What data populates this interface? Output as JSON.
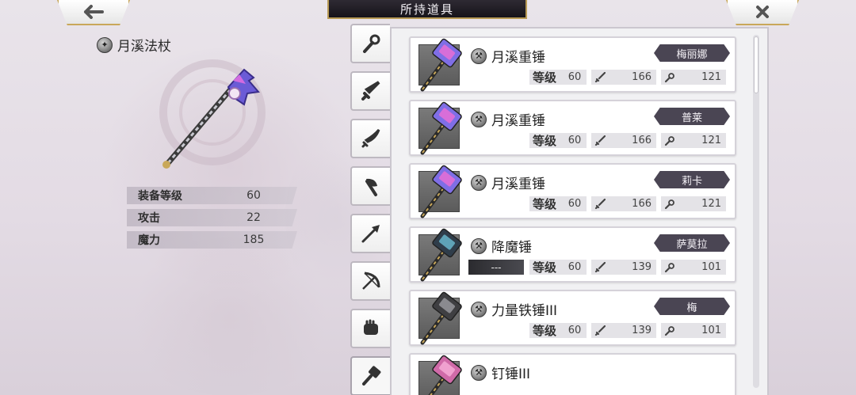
{
  "header": {
    "title": "所持道具",
    "back_icon": "back-arrow-icon",
    "close_icon": "close-icon"
  },
  "detail": {
    "name": "月溪法杖",
    "stats": [
      {
        "label": "装备等级",
        "value": "60"
      },
      {
        "label": "攻击",
        "value": "22"
      },
      {
        "label": "魔力",
        "value": "185"
      }
    ]
  },
  "tabs": [
    "staff-icon",
    "sword-icon",
    "blade-icon",
    "axe-icon",
    "spear-icon",
    "bow-icon",
    "fist-icon",
    "hammer-icon"
  ],
  "active_tab": "hammer-icon",
  "list": {
    "level_label": "等级",
    "items": [
      {
        "name": "月溪重锤",
        "owner": "梅丽娜",
        "level": "60",
        "attack": "166",
        "magic": "121",
        "equip": ""
      },
      {
        "name": "月溪重锤",
        "owner": "普莱",
        "level": "60",
        "attack": "166",
        "magic": "121",
        "equip": ""
      },
      {
        "name": "月溪重锤",
        "owner": "莉卡",
        "level": "60",
        "attack": "166",
        "magic": "121",
        "equip": ""
      },
      {
        "name": "降魔锤",
        "owner": "萨莫拉",
        "level": "60",
        "attack": "139",
        "magic": "101",
        "equip": "---"
      },
      {
        "name": "力量铁锤III",
        "owner": "梅",
        "level": "60",
        "attack": "139",
        "magic": "101",
        "equip": ""
      },
      {
        "name": "钉锤III",
        "owner": "",
        "level": "",
        "attack": "",
        "magic": "",
        "equip": ""
      }
    ]
  },
  "colors": {
    "accent_gold": "#c9a85a",
    "owner_tag": "#4a4553",
    "title_bg": "#16141a"
  }
}
